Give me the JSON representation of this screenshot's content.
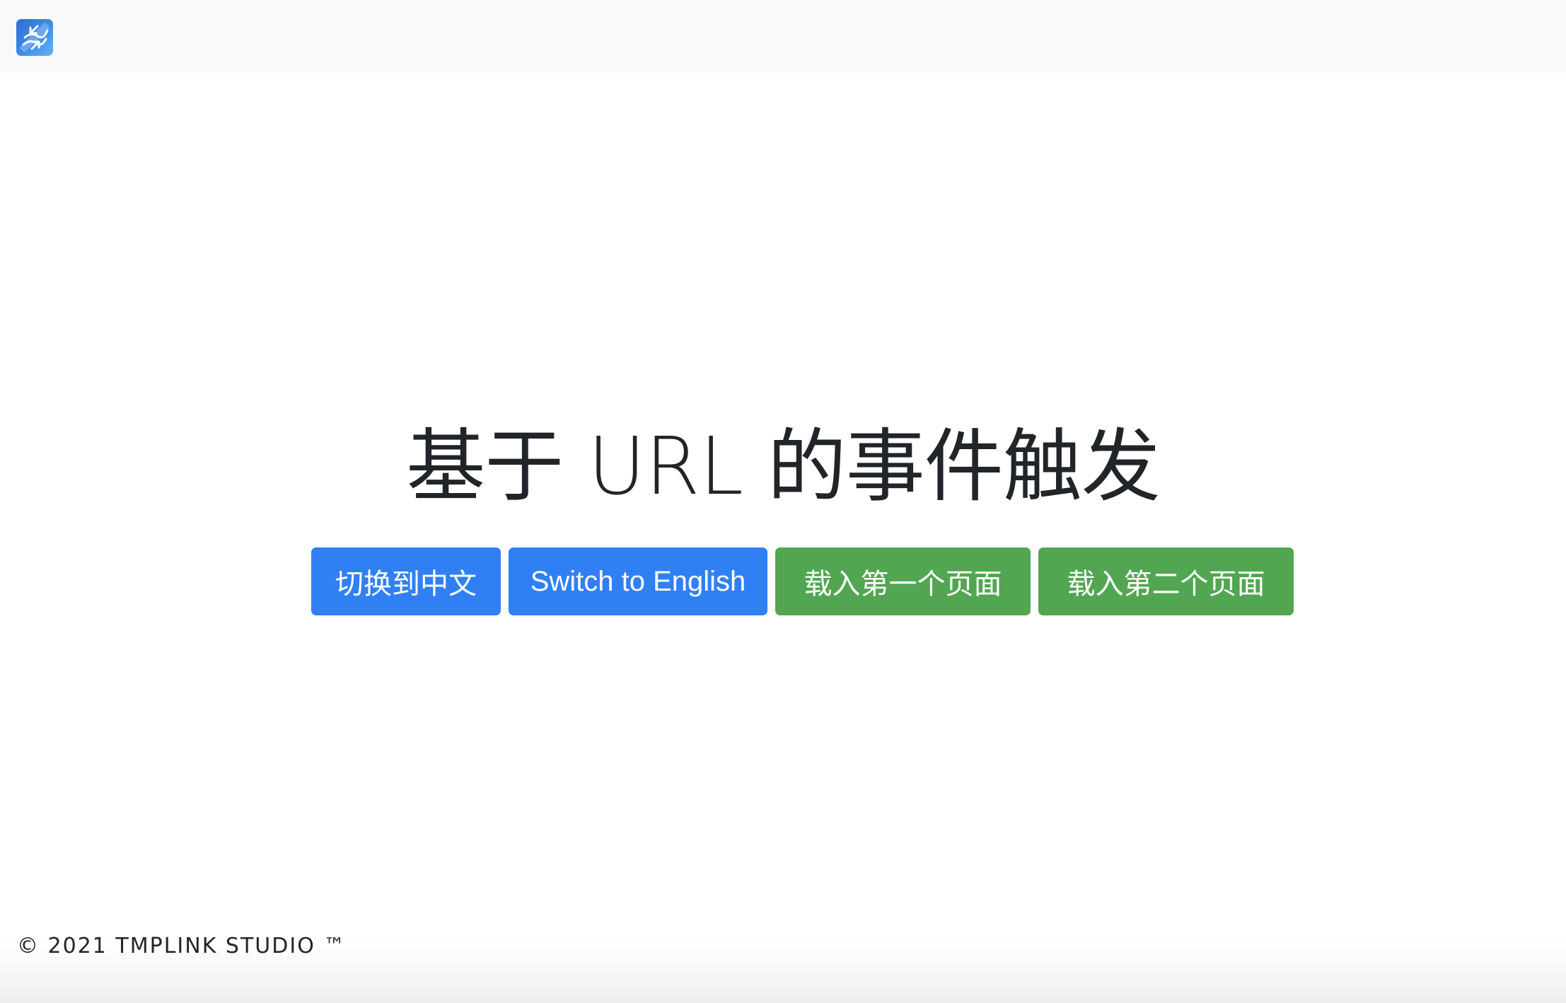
{
  "navbar": {
    "logo_icon": "tmplink-logo-icon"
  },
  "hero": {
    "title": "基于 URL 的事件触发"
  },
  "buttons": [
    {
      "label": "切换到中文",
      "color": "#3080f4"
    },
    {
      "label": "Switch to English",
      "color": "#3080f4"
    },
    {
      "label": "载入第一个页面",
      "color": "#52a652"
    },
    {
      "label": "载入第二个页面",
      "color": "#52a652"
    }
  ],
  "footer": {
    "text": "© 2021 TMPLINK STUDIO ™"
  },
  "colors": {
    "navbar_bg": "#f8f9fa",
    "primary": "#3080f4",
    "success": "#52a652",
    "text": "#212529"
  }
}
